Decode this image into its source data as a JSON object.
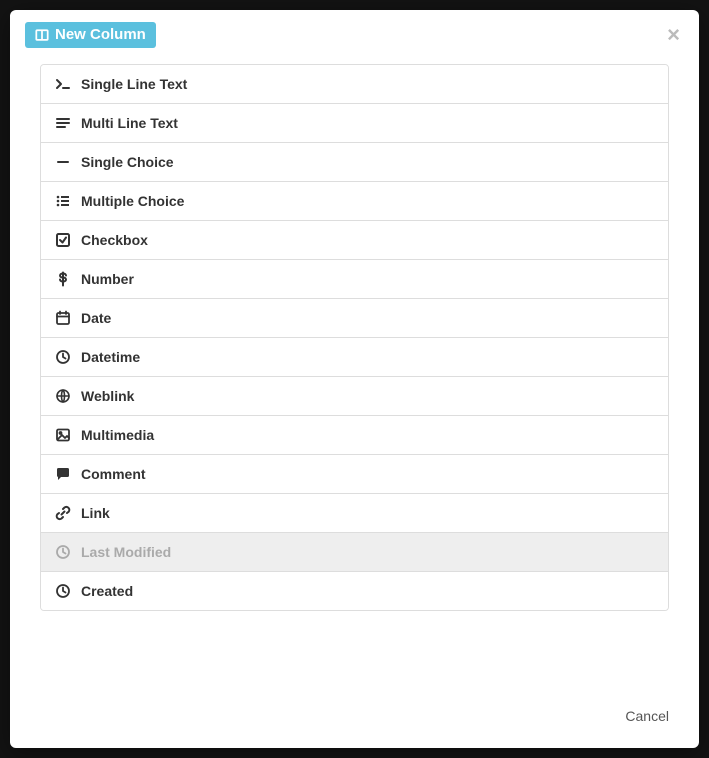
{
  "modal": {
    "title": "New Column",
    "close_label": "×",
    "cancel_label": "Cancel",
    "column_types": [
      {
        "icon": "terminal-icon",
        "label": "Single Line Text",
        "disabled": false
      },
      {
        "icon": "align-left-icon",
        "label": "Multi Line Text",
        "disabled": false
      },
      {
        "icon": "minus-icon",
        "label": "Single Choice",
        "disabled": false
      },
      {
        "icon": "list-icon",
        "label": "Multiple Choice",
        "disabled": false
      },
      {
        "icon": "check-square-icon",
        "label": "Checkbox",
        "disabled": false
      },
      {
        "icon": "dollar-icon",
        "label": "Number",
        "disabled": false
      },
      {
        "icon": "calendar-icon",
        "label": "Date",
        "disabled": false
      },
      {
        "icon": "clock-icon",
        "label": "Datetime",
        "disabled": false
      },
      {
        "icon": "globe-icon",
        "label": "Weblink",
        "disabled": false
      },
      {
        "icon": "image-icon",
        "label": "Multimedia",
        "disabled": false
      },
      {
        "icon": "comment-icon",
        "label": "Comment",
        "disabled": false
      },
      {
        "icon": "link-icon",
        "label": "Link",
        "disabled": false
      },
      {
        "icon": "clock-icon",
        "label": "Last Modified",
        "disabled": true
      },
      {
        "icon": "clock-icon",
        "label": "Created",
        "disabled": false
      }
    ]
  }
}
